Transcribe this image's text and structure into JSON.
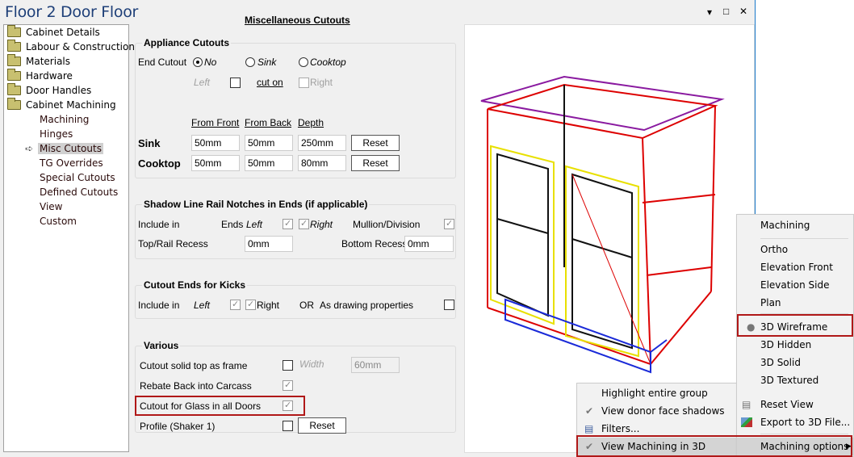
{
  "window": {
    "title": "Floor 2 Door Floor",
    "controls": [
      "▾",
      "□",
      "✕"
    ]
  },
  "tree": {
    "folders": [
      "Cabinet Details",
      "Labour & Construction",
      "Materials",
      "Hardware",
      "Door Handles",
      "Cabinet Machining"
    ],
    "children": [
      "Machining",
      "Hinges",
      "Misc Cutouts",
      "TG Overrides",
      "Special Cutouts",
      "Defined Cutouts",
      "View",
      "Custom"
    ],
    "selected": "Misc Cutouts"
  },
  "form": {
    "title": "Miscellaneous Cutouts",
    "appliance": {
      "title": "Appliance Cutouts",
      "end_cutout_label": "End Cutout",
      "options": [
        "No",
        "Sink",
        "Cooktop"
      ],
      "selected": "No",
      "left_label": "Left",
      "cut_on_label": "cut on",
      "right_label": "Right",
      "left_checked": false,
      "right_checked": false,
      "columns": [
        "From Front",
        "From Back",
        "Depth"
      ],
      "rows": [
        {
          "label": "Sink",
          "values": [
            "50mm",
            "50mm",
            "250mm"
          ],
          "button": "Reset"
        },
        {
          "label": "Cooktop",
          "values": [
            "50mm",
            "50mm",
            "80mm"
          ],
          "button": "Reset"
        }
      ]
    },
    "shadow": {
      "title": "Shadow Line Rail Notches in Ends (if applicable)",
      "include_label": "Include in",
      "ends_label": "Ends",
      "left_label": "Left",
      "right_label": "Right",
      "mullion_label": "Mullion/Division",
      "left_checked": true,
      "right_checked": true,
      "mullion_checked": true,
      "top_recess_label": "Top/Rail Recess",
      "top_recess": "0mm",
      "bottom_recess_label": "Bottom Recess",
      "bottom_recess": "0mm"
    },
    "kicks": {
      "title": "Cutout Ends for Kicks",
      "include_label": "Include in",
      "left_label": "Left",
      "right_label": "Right",
      "or_label": "OR",
      "drawing_label": "As drawing properties",
      "left_checked": true,
      "right_checked": true,
      "drawing_checked": false
    },
    "various": {
      "title": "Various",
      "solid_top_label": "Cutout solid top as frame",
      "solid_top_checked": false,
      "width_label": "Width",
      "width_value": "60mm",
      "rebate_label": "Rebate Back into Carcass",
      "rebate_checked": true,
      "glass_label": "Cutout for Glass in all Doors",
      "glass_checked": true,
      "profile_label": "Profile (Shaker 1)",
      "profile_checked": false,
      "profile_button": "Reset"
    }
  },
  "context_menu": {
    "items": [
      "Machining",
      "Ortho",
      "Elevation Front",
      "Elevation Side",
      "Plan",
      "3D Wireframe",
      "3D Hidden",
      "3D Solid",
      "3D Textured",
      "Reset View",
      "Export to 3D File...",
      "Machining options"
    ],
    "selected": "3D Wireframe"
  },
  "submenu": {
    "items": [
      "Highlight entire group",
      "View donor face shadows",
      "Filters...",
      "View Machining in 3D"
    ],
    "checked": [
      "View donor face shadows",
      "View Machining in 3D"
    ]
  },
  "colors": {
    "highlight_box": "#b01818",
    "title": "#1e3f78"
  }
}
